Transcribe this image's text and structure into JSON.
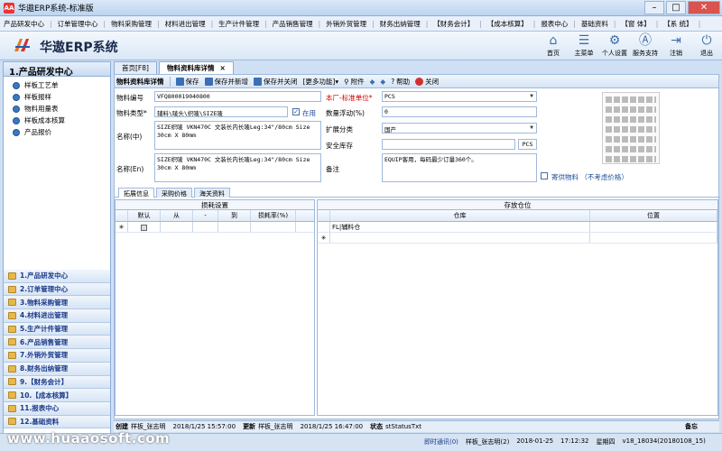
{
  "window": {
    "title": "华遨ERP系统-标准版",
    "app_icon": "AA"
  },
  "menu": [
    "产品研发中心",
    "订单管理中心",
    "物料采购管理",
    "材料进出管理",
    "生产计件管理",
    "产品销售管理",
    "外销外贸管理",
    "财务出纳管理",
    "【财务会计】",
    "【成本核算】",
    "报表中心",
    "基础资料",
    "【窗 体】",
    "【系 统】"
  ],
  "brand": {
    "name": "华遨ERP系统"
  },
  "header_icons": [
    {
      "label": "首页",
      "icon": "home-icon",
      "glyph": "⌂"
    },
    {
      "label": "主菜单",
      "icon": "menu-icon",
      "glyph": "☰"
    },
    {
      "label": "个人设置",
      "icon": "gear-icon",
      "glyph": "⚙"
    },
    {
      "label": "服务支持",
      "icon": "support-icon",
      "glyph": "Ⓐ"
    },
    {
      "label": "注销",
      "icon": "logout-icon",
      "glyph": "⇥"
    },
    {
      "label": "退出",
      "icon": "power-icon",
      "glyph": "⏻"
    }
  ],
  "sidebar": {
    "title": "1.产品研发中心",
    "tree": [
      "样板工艺单",
      "样板报样",
      "物料用量表",
      "样板成本核算",
      "产品报价"
    ],
    "modules": [
      "1.产品研发中心",
      "2.订单管理中心",
      "3.物料采购管理",
      "4.材料进出管理",
      "5.生产计件管理",
      "6.产品销售管理",
      "7.外销外贸管理",
      "8.财务出纳管理",
      "9.【财务会计】",
      "10.【成本核算】",
      "11.报表中心",
      "12.基础资料"
    ]
  },
  "tabs": [
    {
      "label": "首页[F8]"
    },
    {
      "label": "物料资料库详情",
      "close": "×"
    }
  ],
  "toolbar": {
    "title": "物料资料库详情",
    "save": "保存",
    "save_new": "保存并新增",
    "save_close": "保存并关闭",
    "more": "[更多功能]",
    "attach": "附件",
    "help": "帮助",
    "close": "关闭"
  },
  "form": {
    "code_label": "物料编号",
    "code_value": "VFQ800019040800",
    "type_label": "物料类型*",
    "type_value": "辅料\\唛头\\织唛\\SIZE唛",
    "enabled_label": "在用",
    "name_cn_label": "名称(中)",
    "name_cn_value": "SIZE织唛 VKN470C 文装长内长唛Leg:34\"/80cm Size 30cm X 80mm",
    "name_en_label": "名称(En)",
    "name_en_value": "SIZE织唛 VKN470C 文装长内长唛Leg:34\"/80cm Size 30cm X 80mm",
    "unit_label": "本厂-标准单位*",
    "unit_value": "PCS",
    "float_label": "数量浮动(%)",
    "float_value": "0",
    "category_label": "扩展分类",
    "category_value": "国产",
    "stock_label": "安全库存",
    "stock_unit": "PCS",
    "remark_label": "备注",
    "remark_value": "EQUIP客用，每码最少订量360个。",
    "supply_label": "寄供物料 （不考虑价格）"
  },
  "subtabs": [
    "拓展信息",
    "采购价格",
    "海关资料"
  ],
  "loss_grid": {
    "title": "损耗设置",
    "columns": [
      "默认",
      "从",
      "-",
      "到",
      "损耗率(%)"
    ]
  },
  "store_grid": {
    "title": "存放仓位",
    "columns": [
      "仓库",
      "位置"
    ],
    "rows": [
      {
        "warehouse": "FL|辅料仓",
        "location": ""
      }
    ]
  },
  "status": {
    "created_label": "创建",
    "created_by": "样板_张志明",
    "created_at": "2018/1/25 15:57:00",
    "updated_label": "更新",
    "updated_by": "样板_张志明",
    "updated_at": "2018/1/25 16:47:00",
    "state_label": "状态",
    "state_value": "stStatusTxt",
    "right": "备忘"
  },
  "bottom": {
    "watermark": "www.huaaosoft.com",
    "notice": "即时通讯(0)",
    "user": "样板_张志明(2)",
    "date": "2018-01-25",
    "time": "17:12:32",
    "weekday": "星期四",
    "version": "v18_18034(20180108_15)"
  }
}
